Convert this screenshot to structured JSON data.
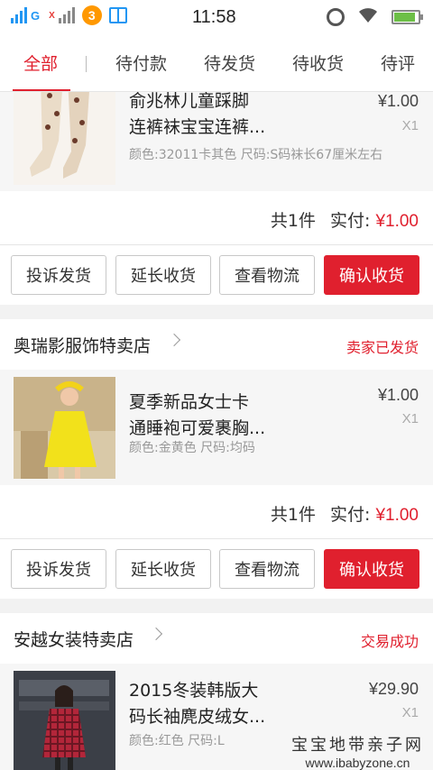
{
  "status_bar": {
    "net_label": "G",
    "badge_count": "3",
    "time": "11:58"
  },
  "tabs": [
    {
      "label": "全部",
      "active": true
    },
    {
      "label": "待付款"
    },
    {
      "label": "待发货"
    },
    {
      "label": "待收货"
    },
    {
      "label": "待评"
    }
  ],
  "orders": [
    {
      "item": {
        "title": "俞兆林儿童踩脚连裤袜宝宝连裤...",
        "title_line1": "俞兆林儿童踩脚",
        "title_line2": "连裤袜宝宝连裤...",
        "spec": "颜色:32011卡其色 尺码:S码袜长67厘米左右",
        "price": "¥1.00",
        "qty": "X1"
      },
      "summary": {
        "count_text": "共1件",
        "paid_label": "实付:",
        "paid_amount": "¥1.00"
      },
      "actions": [
        "投诉发货",
        "延长收货",
        "查看物流",
        "确认收货"
      ]
    },
    {
      "shop_name": "奥瑞影服饰特卖店",
      "status": "卖家已发货",
      "item": {
        "title_line1": "夏季新品女士卡",
        "title_line2": "通睡袍可爱裹胸...",
        "spec": "颜色:金黄色 尺码:均码",
        "price": "¥1.00",
        "qty": "X1"
      },
      "summary": {
        "count_text": "共1件",
        "paid_label": "实付:",
        "paid_amount": "¥1.00"
      },
      "actions": [
        "投诉发货",
        "延长收货",
        "查看物流",
        "确认收货"
      ]
    },
    {
      "shop_name": "安越女装特卖店",
      "status": "交易成功",
      "item": {
        "title_line1": "2015冬装韩版大",
        "title_line2": "码长袖麂皮绒女...",
        "spec": "颜色:红色 尺码:L",
        "price": "¥29.90",
        "qty": "X1"
      }
    }
  ],
  "watermark": {
    "line1": "宝宝地带亲子网",
    "line2": "www.ibabyzone.cn"
  },
  "colors": {
    "accent": "#e0202e",
    "background": "#f2f2f2"
  }
}
